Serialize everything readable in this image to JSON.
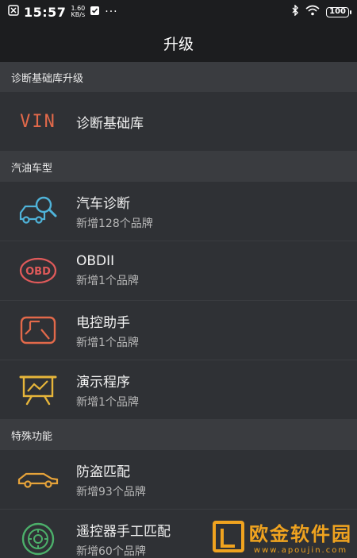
{
  "status_bar": {
    "time": "15:57",
    "speed_value": "1.60",
    "speed_unit": "KB/s",
    "dots": "···",
    "battery": "100"
  },
  "app_bar": {
    "title": "升级"
  },
  "sections": [
    {
      "header": "诊断基础库升级"
    },
    {
      "header": "汽油车型"
    },
    {
      "header": "特殊功能"
    }
  ],
  "rows": {
    "base": {
      "title": "诊断基础库",
      "icon_text": "VIN"
    },
    "car_diag": {
      "title": "汽车诊断",
      "subtitle": "新增128个品牌"
    },
    "obdii": {
      "title": "OBDII",
      "subtitle": "新增1个品牌",
      "icon_text": "OBD"
    },
    "ecu": {
      "title": "电控助手",
      "subtitle": "新增1个品牌"
    },
    "demo": {
      "title": "演示程序",
      "subtitle": "新增1个品牌"
    },
    "immo": {
      "title": "防盗匹配",
      "subtitle": "新增93个品牌"
    },
    "remote": {
      "title": "遥控器手工匹配",
      "subtitle": "新增60个品牌"
    }
  },
  "watermark": {
    "main": "欧金软件园",
    "url": "www.apoujin.com"
  },
  "colors": {
    "vin": "#e2694a",
    "car_icon": "#4fb3d9",
    "obd_icon": "#e05a5a",
    "ecu_icon": "#e2694a",
    "demo_icon": "#e6b53a",
    "immo_icon": "#e6a33a",
    "remote_icon": "#4caf6a"
  }
}
